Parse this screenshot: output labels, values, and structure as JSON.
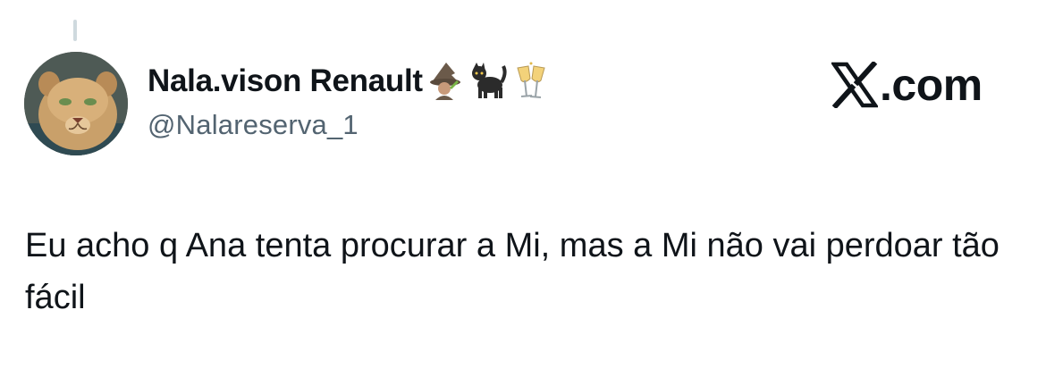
{
  "tweet": {
    "author": {
      "display_name": "Nala.vison Renault",
      "handle": "@Nalareserva_1",
      "name_emojis": [
        "mage-emoji",
        "black-cat-emoji",
        "clinking-glasses-emoji"
      ],
      "avatar": "lioness-avatar"
    },
    "text": "Eu acho q Ana tenta procurar a Mi, mas a Mi não vai perdoar tão fácil"
  },
  "brand": {
    "text": ".com",
    "logo": "x-logo-icon"
  },
  "colors": {
    "text": "#0f1419",
    "secondary_text": "#536471",
    "thread_line": "#cfd9de",
    "background": "#ffffff"
  }
}
